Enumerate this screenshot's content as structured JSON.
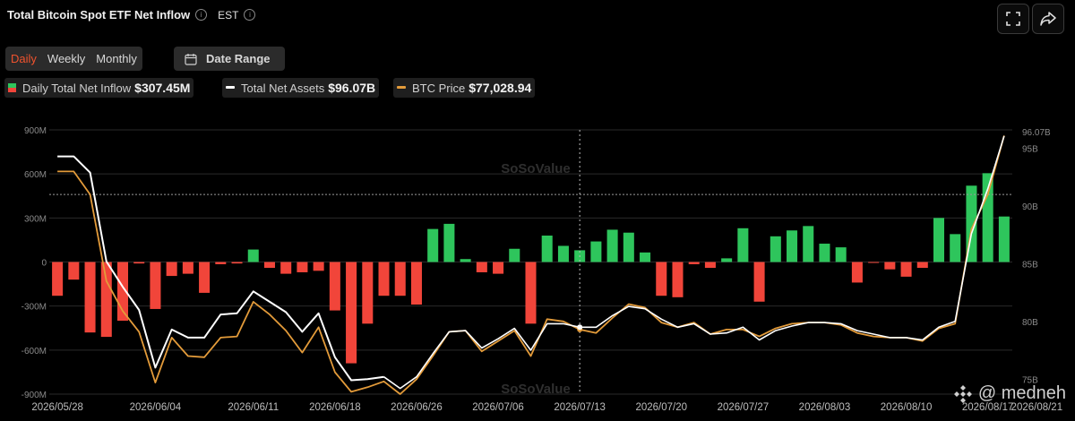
{
  "header": {
    "title": "Total Bitcoin Spot ETF Net Inflow",
    "timezone": "EST",
    "fullscreen_icon": "fullscreen-icon",
    "share_icon": "share-icon"
  },
  "period_tabs": [
    "Daily",
    "Weekly",
    "Monthly"
  ],
  "active_period": "Daily",
  "date_range_label": "Date Range",
  "legend": [
    {
      "label": "Daily Total Net Inflow",
      "value": "$307.45M"
    },
    {
      "label": "Total Net Assets",
      "value": "$96.07B"
    },
    {
      "label": "BTC Price",
      "value": "$77,028.94"
    }
  ],
  "watermark": "SoSoValue",
  "attribution": "@ medneh",
  "colors": {
    "positive": "#2ec55c",
    "negative": "#f1453a",
    "assets": "#ffffff",
    "price": "#e39b3a",
    "grid": "#2a2a2a"
  },
  "chart_data": {
    "type": "bar",
    "left_axis": {
      "ticks": [
        "900M",
        "600M",
        "300M",
        "0",
        "-300M",
        "-600M",
        "-900M"
      ],
      "range": [
        -900,
        900
      ],
      "unit": "M"
    },
    "right_axis": {
      "ticks": [
        "95B",
        "90B",
        "85B",
        "80B",
        "75B"
      ],
      "range": [
        73.7,
        96.6
      ],
      "unit": "B"
    },
    "right_axis_marker": "96.07B",
    "x_tick_labels": [
      "2026/05/28",
      "2026/06/04",
      "2026/06/11",
      "2026/06/18",
      "2026/06/26",
      "2026/07/06",
      "2026/07/13",
      "2026/07/20",
      "2026/07/27",
      "2026/08/03",
      "2026/08/10",
      "2026/08/17",
      "2026/08/21"
    ],
    "x_tick_positions": [
      0,
      6,
      12,
      17,
      22,
      27,
      32,
      37,
      42,
      47,
      52,
      57,
      60
    ],
    "series": [
      {
        "name": "Daily Total Net Inflow",
        "values": [
          -230,
          -120,
          -480,
          -510,
          -400,
          -10,
          -320,
          -95,
          -80,
          -210,
          -15,
          -10,
          85,
          -40,
          -80,
          -70,
          -60,
          -330,
          -690,
          -420,
          -230,
          -230,
          -290,
          225,
          260,
          20,
          -70,
          -80,
          90,
          -420,
          180,
          110,
          80,
          140,
          220,
          200,
          65,
          -230,
          -240,
          -15,
          -40,
          25,
          230,
          -270,
          175,
          215,
          245,
          125,
          100,
          -140,
          -5,
          -50,
          -100,
          -40,
          300,
          190,
          520,
          605,
          310
        ],
        "axis": "left"
      },
      {
        "name": "Total Net Assets",
        "values": [
          94.3,
          94.3,
          92.9,
          85.2,
          83.0,
          81.0,
          76.0,
          79.3,
          78.6,
          78.6,
          80.6,
          80.7,
          82.6,
          81.7,
          80.8,
          79.1,
          80.7,
          76.9,
          74.9,
          75.0,
          75.2,
          null,
          null,
          null,
          null,
          null,
          null,
          null,
          null,
          null,
          null,
          null,
          null,
          null,
          null,
          null,
          null,
          null,
          null,
          null,
          null,
          null,
          null,
          null,
          null,
          null,
          null,
          null,
          null,
          null,
          null,
          null,
          null,
          null,
          null,
          null,
          null,
          null,
          null
        ],
        "axis": "right"
      },
      {
        "name": "BTC Price",
        "values": [
          93.0,
          93.0,
          91.0,
          83.5,
          80.9,
          79.1,
          74.7,
          78.6,
          77.0,
          76.9,
          78.6,
          78.7,
          81.7,
          80.6,
          79.2,
          77.3,
          79.5,
          75.6,
          73.9,
          74.3,
          74.8,
          73.7,
          75.0,
          77.0,
          79.1,
          79.2,
          77.4,
          78.3,
          79.2,
          77.0,
          80.2,
          80.0,
          79.3,
          79.0,
          80.3,
          81.5,
          81.2,
          79.9,
          79.5,
          79.9,
          78.9,
          79.3,
          79.3,
          78.7,
          79.4,
          79.8,
          79.9,
          79.9,
          79.7,
          79.0,
          78.7,
          78.6,
          78.6,
          78.3,
          79.4,
          79.8,
          88.0,
          91.0,
          96.1
        ],
        "axis": "right"
      },
      {
        "name": "Total Net Assets (after 06/26)",
        "values": [
          null,
          null,
          null,
          null,
          null,
          null,
          null,
          null,
          null,
          null,
          null,
          null,
          null,
          null,
          null,
          null,
          null,
          null,
          null,
          null,
          75.2,
          74.2,
          75.2,
          77.2,
          79.1,
          79.2,
          77.7,
          78.5,
          79.4,
          77.5,
          79.8,
          79.8,
          79.5,
          79.5,
          80.5,
          81.3,
          81.1,
          80.2,
          79.5,
          79.8,
          78.9,
          79.0,
          79.5,
          78.4,
          79.2,
          79.6,
          79.9,
          79.9,
          79.8,
          79.2,
          78.9,
          78.6,
          78.6,
          78.4,
          79.5,
          80.0,
          87.6,
          91.5,
          96.07
        ],
        "axis": "right"
      }
    ],
    "crosshair_index": 32,
    "reference_level": 91.0
  }
}
